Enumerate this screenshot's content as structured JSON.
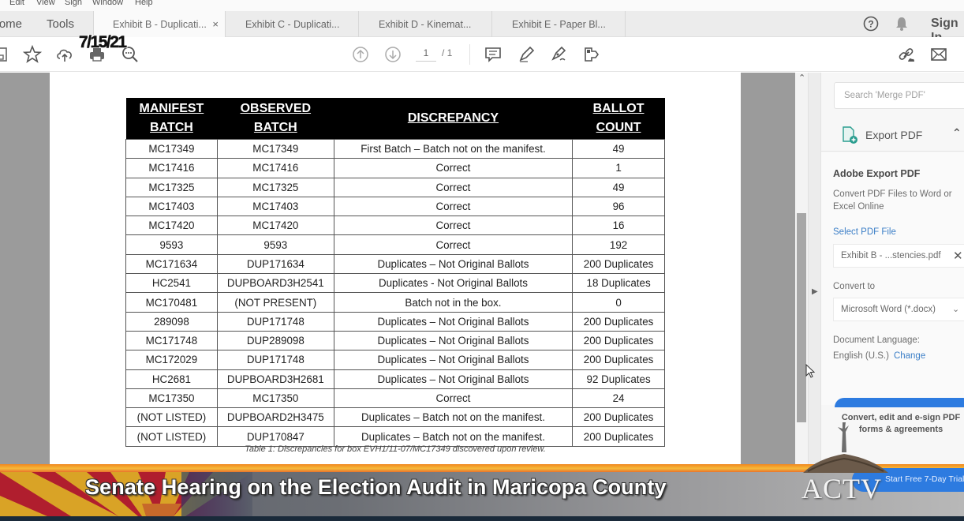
{
  "overlay": {
    "date": "7/15/21"
  },
  "menu": [
    "Edit",
    "View",
    "Sign",
    "Window",
    "Help"
  ],
  "tabbar": {
    "home": "Home",
    "tools": "Tools",
    "tabs": [
      {
        "label": "Exhibit B - Duplicati...",
        "active": true,
        "close": "×"
      },
      {
        "label": "Exhibit C - Duplicati...",
        "active": false
      },
      {
        "label": "Exhibit D - Kinemat...",
        "active": false
      },
      {
        "label": "Exhibit E - Paper Bl...",
        "active": false
      }
    ],
    "sign_in": "Sign In"
  },
  "toolbar": {
    "page_current": "1",
    "page_total": "/ 1"
  },
  "table": {
    "headers": [
      [
        "MANIFEST",
        "BATCH"
      ],
      [
        "OBSERVED",
        "BATCH"
      ],
      [
        "DISCREPANCY"
      ],
      [
        "BALLOT",
        "COUNT"
      ]
    ],
    "rows": [
      [
        "MC17349",
        "MC17349",
        "First Batch – Batch not on the manifest.",
        "49"
      ],
      [
        "MC17416",
        "MC17416",
        "Correct",
        "1"
      ],
      [
        "MC17325",
        "MC17325",
        "Correct",
        "49"
      ],
      [
        "MC17403",
        "MC17403",
        "Correct",
        "96"
      ],
      [
        "MC17420",
        "MC17420",
        "Correct",
        "16"
      ],
      [
        "9593",
        "9593",
        "Correct",
        "192"
      ],
      [
        "MC171634",
        "DUP171634",
        "Duplicates – Not Original Ballots",
        "200 Duplicates"
      ],
      [
        "HC2541",
        "DUPBOARD3H2541",
        "Duplicates - Not Original Ballots",
        "18 Duplicates"
      ],
      [
        "MC170481",
        "(NOT PRESENT)",
        "Batch not in the box.",
        "0"
      ],
      [
        "289098",
        "DUP171748",
        "Duplicates – Not Original Ballots",
        "200 Duplicates"
      ],
      [
        "MC171748",
        "DUP289098",
        "Duplicates – Not Original Ballots",
        "200 Duplicates"
      ],
      [
        "MC172029",
        "DUP171748",
        "Duplicates – Not Original Ballots",
        "200 Duplicates"
      ],
      [
        "HC2681",
        "DUPBOARD3H2681",
        "Duplicates – Not Original Ballots",
        "92 Duplicates"
      ],
      [
        "MC17350",
        "MC17350",
        "Correct",
        "24"
      ],
      [
        "(NOT LISTED)",
        "DUPBOARD2H3475",
        "Duplicates – Batch not on the manifest.",
        "200 Duplicates"
      ],
      [
        "(NOT LISTED)",
        "DUP170847",
        "Duplicates – Batch not on the manifest.",
        "200 Duplicates"
      ]
    ],
    "caption": "Table 1: Discrepancies for box EVH1/11-07/MC17349 discovered upon review."
  },
  "right_pane": {
    "search_placeholder": "Search 'Merge PDF'",
    "export_label": "Export PDF",
    "panel_title": "Adobe Export PDF",
    "panel_desc": "Convert PDF Files to Word or Excel Online",
    "select_file_label": "Select PDF File",
    "file_name": "Exhibit B - ...stencies.pdf",
    "convert_to_label": "Convert to",
    "convert_to_value": "Microsoft Word (*.docx)",
    "doc_lang_label": "Document Language:",
    "doc_lang_value": "English (U.S.)",
    "change_link": "Change",
    "promo_line1": "Convert, edit and e-sign PDF",
    "promo_line2": "forms & agreements",
    "trial_button": "Start Free 7-Day Trial"
  },
  "broadcast": {
    "title": "Senate Hearing on the Election Audit in Maricopa County",
    "logo": "ACTV"
  },
  "colors": {
    "accent_blue": "#2d7be0",
    "link_blue": "#3c7fc7",
    "lower_third_orange": "#f0871f"
  }
}
